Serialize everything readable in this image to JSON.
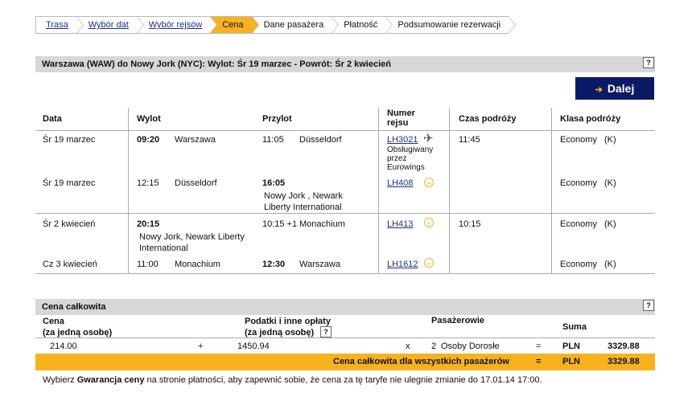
{
  "breadcrumb": [
    "Trasa",
    "Wybór dat",
    "Wybór rejsów",
    "Cena",
    "Dane pasażera",
    "Płatność",
    "Podsumowanie rezerwacji"
  ],
  "route_header": "Warszawa (WAW) do Nowy Jork (NYC): Wylot: Śr 19 marzec  - Powrót: Śr 2 kwiecień",
  "help_label": "?",
  "dalej_label": "Dalej",
  "columns": {
    "data": "Data",
    "wylot": "Wylot",
    "przylot": "Przylot",
    "numer_line1": "Numer",
    "numer_line2": "rejsu",
    "czas": "Czas podróży",
    "klasa": "Klasa podróży"
  },
  "flights": [
    {
      "date": "Śr 19 marzec",
      "dep_time": "09:20",
      "dep_city": "Warszawa",
      "arr_time": "11:05",
      "arr_city": "Düsseldorf",
      "flight_no": "LH3021",
      "operated": [
        "Obsługiwany",
        "przez",
        "Eurowings"
      ],
      "duration": "11:45",
      "class": "Economy",
      "class_code": "(K)",
      "carrier_icon": "plane-icon"
    },
    {
      "date": "Śr 19 marzec",
      "dep_time": "12:15",
      "dep_city": "Düsseldorf",
      "arr_time": "16:05",
      "arr_city_line1": "Nowy Jork , Newark",
      "arr_city_line2": "Liberty International",
      "flight_no": "LH408",
      "class": "Economy",
      "class_code": "(K)",
      "carrier_icon": "lufthansa-logo-icon"
    },
    {
      "date": "Śr 2 kwiecień",
      "dep_time": "20:15",
      "dep_city_line1": "Nowy Jork, Newark Liberty",
      "dep_city_line2": "International",
      "arr_time": "10:15 +1",
      "arr_city": "Monachium",
      "flight_no": "LH413",
      "duration": "10:15",
      "class": "Economy",
      "class_code": "(K)",
      "carrier_icon": "lufthansa-logo-icon"
    },
    {
      "date": "Cz 3 kwiecień",
      "dep_time": "11:00",
      "dep_city": "Monachium",
      "arr_time": "12:30",
      "arr_city": "Warszawa",
      "flight_no": "LH1612",
      "class": "Economy",
      "class_code": "(K)",
      "carrier_icon": "lufthansa-logo-icon"
    }
  ],
  "price": {
    "header": "Cena całkowita",
    "cena_line1": "Cena",
    "cena_line2": "(za jedną osobę)",
    "taxes_line1": "Podatki i inne opłaty",
    "taxes_line2": "(za jedną osobę)",
    "passengers_header": "Pasażerowie",
    "suma_header": "Suma",
    "base": "214.00",
    "plus": "+",
    "taxes": "1450.94",
    "times": "x",
    "pax_count": "2",
    "pax_label": "Osoby Dorosłe",
    "eq": "=",
    "currency": "PLN",
    "sum": "3329.88",
    "total_label": "Cena całkowita dla wszystkich pasażerów",
    "total_currency": "PLN",
    "total_sum": "3329.88"
  },
  "footer_note": {
    "prefix": "Wybierz ",
    "bold": "Gwarancja ceny",
    "suffix": " na stronie płatności, aby zapewnić sobie, że cena za tę taryfe nie ulegnie zmianie do 17.01.14 17:00."
  },
  "colors": {
    "accent": "#f8b21e",
    "navy": "#0b1a64",
    "bar": "#d7d7d7",
    "link": "#1b2f8f"
  }
}
